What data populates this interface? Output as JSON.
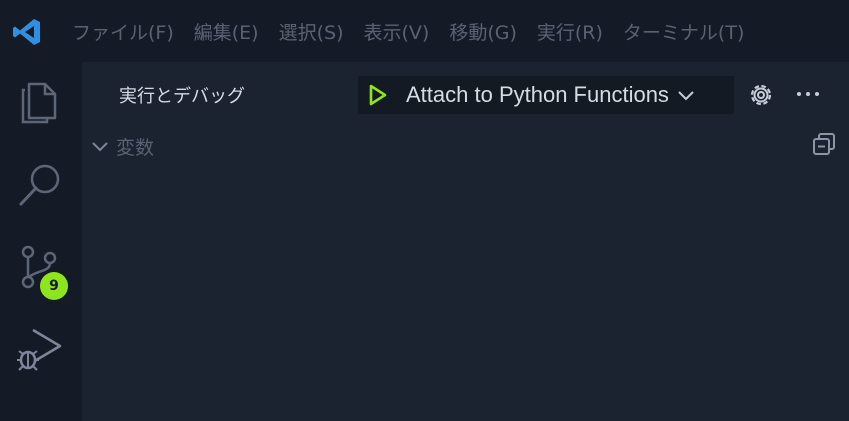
{
  "menu": [
    {
      "id": "file",
      "label": "ファイル(F)"
    },
    {
      "id": "edit",
      "label": "編集(E)"
    },
    {
      "id": "selection",
      "label": "選択(S)"
    },
    {
      "id": "view",
      "label": "表示(V)"
    },
    {
      "id": "go",
      "label": "移動(G)"
    },
    {
      "id": "run",
      "label": "実行(R)"
    },
    {
      "id": "terminal",
      "label": "ターミナル(T)"
    }
  ],
  "activity": {
    "scm_badge": "9"
  },
  "sidebar": {
    "title": "実行とデバッグ",
    "launch_config": "Attach to Python Functions",
    "variables_section": "変数"
  },
  "icons": {
    "logo": "vscode-logo",
    "explorer": "files-icon",
    "search": "search-icon",
    "scm": "source-control-icon",
    "debug": "run-debug-icon",
    "play": "play-icon",
    "gear": "gear-icon",
    "more": "ellipsis-icon",
    "collapse": "collapse-all-icon"
  },
  "colors": {
    "accent": "#8fe51c",
    "logo": "#2f8fe0",
    "titlebar": "#151b26",
    "sidebar": "#1b2230"
  }
}
